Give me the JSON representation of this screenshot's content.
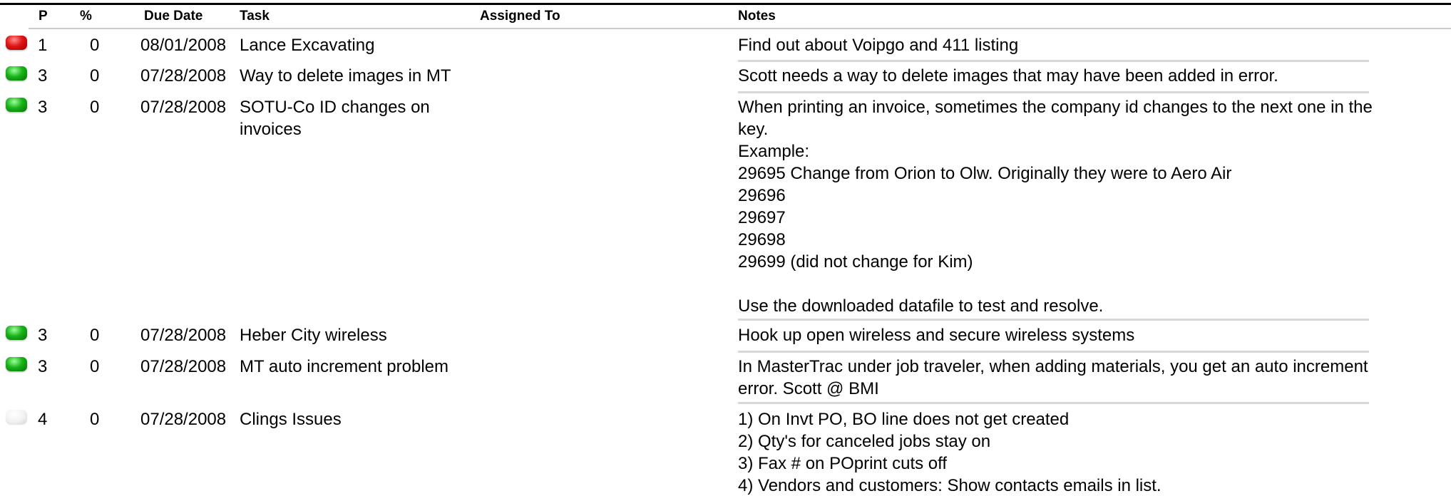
{
  "columns": {
    "priority": "P",
    "percent": "%",
    "due_date": "Due Date",
    "task": "Task",
    "assigned_to": "Assigned To",
    "notes": "Notes"
  },
  "tasks": [
    {
      "priority": "1",
      "status_color": "red",
      "percent": "0",
      "due_date": "08/01/2008",
      "task": "Lance Excavating",
      "assigned_to": "",
      "notes": "Find out about Voipgo and 411 listing"
    },
    {
      "priority": "3",
      "status_color": "green",
      "percent": "0",
      "due_date": "07/28/2008",
      "task": "Way to delete images in MT",
      "assigned_to": "",
      "notes": "Scott needs a way to delete images that may have been added in error."
    },
    {
      "priority": "3",
      "status_color": "green",
      "percent": "0",
      "due_date": "07/28/2008",
      "task": "SOTU-Co ID changes on\ninvoices",
      "assigned_to": "",
      "notes": "When printing an invoice, sometimes the company id changes to the next one in the\nkey.\nExample:\n29695 Change from Orion to Olw.  Originally they were to Aero Air\n29696\n29697\n29698\n29699 (did not change for Kim)\n\nUse the downloaded datafile to test and resolve."
    },
    {
      "priority": "3",
      "status_color": "green",
      "percent": "0",
      "due_date": "07/28/2008",
      "task": "Heber City wireless",
      "assigned_to": "",
      "notes": "Hook up open wireless and secure wireless systems"
    },
    {
      "priority": "3",
      "status_color": "green",
      "percent": "0",
      "due_date": "07/28/2008",
      "task": "MT auto increment problem",
      "assigned_to": "",
      "notes": "In MasterTrac under job traveler, when adding materials, you get an auto increment\nerror. Scott @ BMI"
    },
    {
      "priority": "4",
      "status_color": "white",
      "percent": "0",
      "due_date": "07/28/2008",
      "task": "Clings Issues",
      "assigned_to": "",
      "notes": "1) On Invt PO, BO line does not get created\n2) Qty's for canceled jobs stay on\n3) Fax # on POprint cuts off\n4) Vendors and customers: Show contacts emails in list."
    }
  ]
}
